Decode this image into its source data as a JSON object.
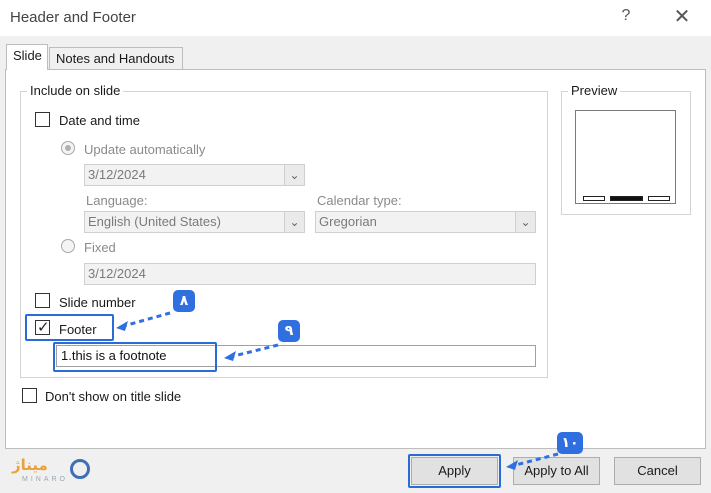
{
  "window": {
    "title": "Header and Footer",
    "help_glyph": "?",
    "close_glyph": "✕"
  },
  "tabs": [
    {
      "label": "Slide"
    },
    {
      "label": "Notes and Handouts"
    }
  ],
  "include_group": {
    "legend": "Include on slide"
  },
  "date_time": {
    "label": "Date and time",
    "checked": false,
    "update_auto_label": "Update automatically",
    "auto_date_value": "3/12/2024",
    "language_label": "Language:",
    "language_value": "English (United States)",
    "calendar_label": "Calendar type:",
    "calendar_value": "Gregorian",
    "fixed_label": "Fixed",
    "fixed_value": "3/12/2024"
  },
  "slide_number": {
    "label": "Slide number",
    "checked": false
  },
  "footer": {
    "label": "Footer",
    "checked": true,
    "value": "1.this is a footnote"
  },
  "dont_show_title": {
    "label": "Don't show on title slide",
    "checked": false
  },
  "preview": {
    "legend": "Preview"
  },
  "buttons": {
    "apply": "Apply",
    "apply_all": "Apply to All",
    "cancel": "Cancel"
  },
  "annotations": {
    "step8": "٨",
    "step9": "٩",
    "step10": "١٠",
    "highlight_color": "#2b6bd6"
  },
  "logo": {
    "text": "میناژ",
    "sub": "MINARO"
  }
}
